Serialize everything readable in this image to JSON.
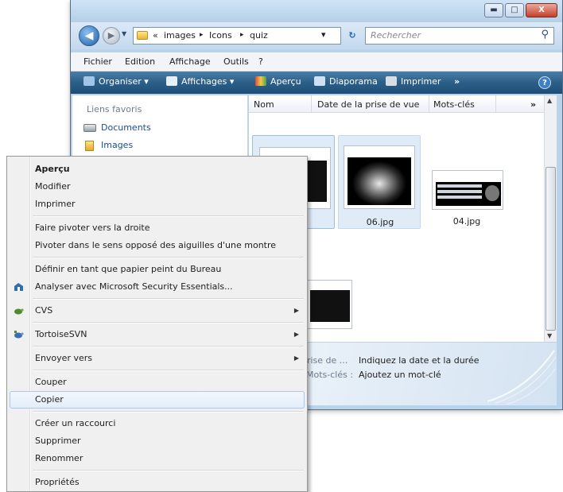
{
  "window": {
    "minimize": "▬",
    "maximize": "□",
    "close": "X",
    "address": {
      "chevron": "«",
      "crumbs": [
        "images",
        "Icons",
        "quiz"
      ],
      "separator": "▸",
      "dropdown": "▾",
      "refresh": "↻"
    },
    "search_placeholder": "Rechercher",
    "search_icon": "⚲"
  },
  "menubar": [
    "Fichier",
    "Edition",
    "Affichage",
    "Outils",
    "?"
  ],
  "toolbar": {
    "organize": "Organiser ▾",
    "views": "Affichages ▾",
    "preview": "Aperçu",
    "slideshow": "Diaporama",
    "print": "Imprimer",
    "more": "»",
    "help": "?"
  },
  "navpane": {
    "heading": "Liens favoris",
    "items": [
      "Documents",
      "Images"
    ]
  },
  "columns": [
    "Nom",
    "Date de la prise de vue",
    "Mots-clés",
    "»"
  ],
  "files": [
    {
      "name": "06.jpg"
    },
    {
      "name": "04.jpg"
    }
  ],
  "details": {
    "row1_label": "prise de ...",
    "row1_value": "Indiquez la date et la durée",
    "row2_label": "Mots-clés :",
    "row2_value": "Ajoutez un mot-clé"
  },
  "context_menu": {
    "items": [
      {
        "label": "Aperçu",
        "bold": true
      },
      {
        "label": "Modifier"
      },
      {
        "label": "Imprimer"
      },
      {
        "label": "Faire pivoter vers la droite"
      },
      {
        "label": "Pivoter dans le sens opposé des aiguilles d'une montre"
      },
      {
        "label": "Définir en tant que papier peint du Bureau"
      },
      {
        "label": "Analyser avec Microsoft Security Essentials..."
      },
      {
        "label": "CVS",
        "submenu": true
      },
      {
        "label": "TortoiseSVN",
        "submenu": true
      },
      {
        "label": "Envoyer vers",
        "submenu": true
      },
      {
        "label": "Couper"
      },
      {
        "label": "Copier",
        "highlighted": true
      },
      {
        "label": "Créer un raccourci"
      },
      {
        "label": "Supprimer"
      },
      {
        "label": "Renommer"
      },
      {
        "label": "Propriétés"
      }
    ],
    "submenu_arrow": "▶"
  },
  "colors": {
    "toolbar": "#2b5f88",
    "menu_highlight": "#a8c8ec",
    "link": "#1a4d8f"
  }
}
